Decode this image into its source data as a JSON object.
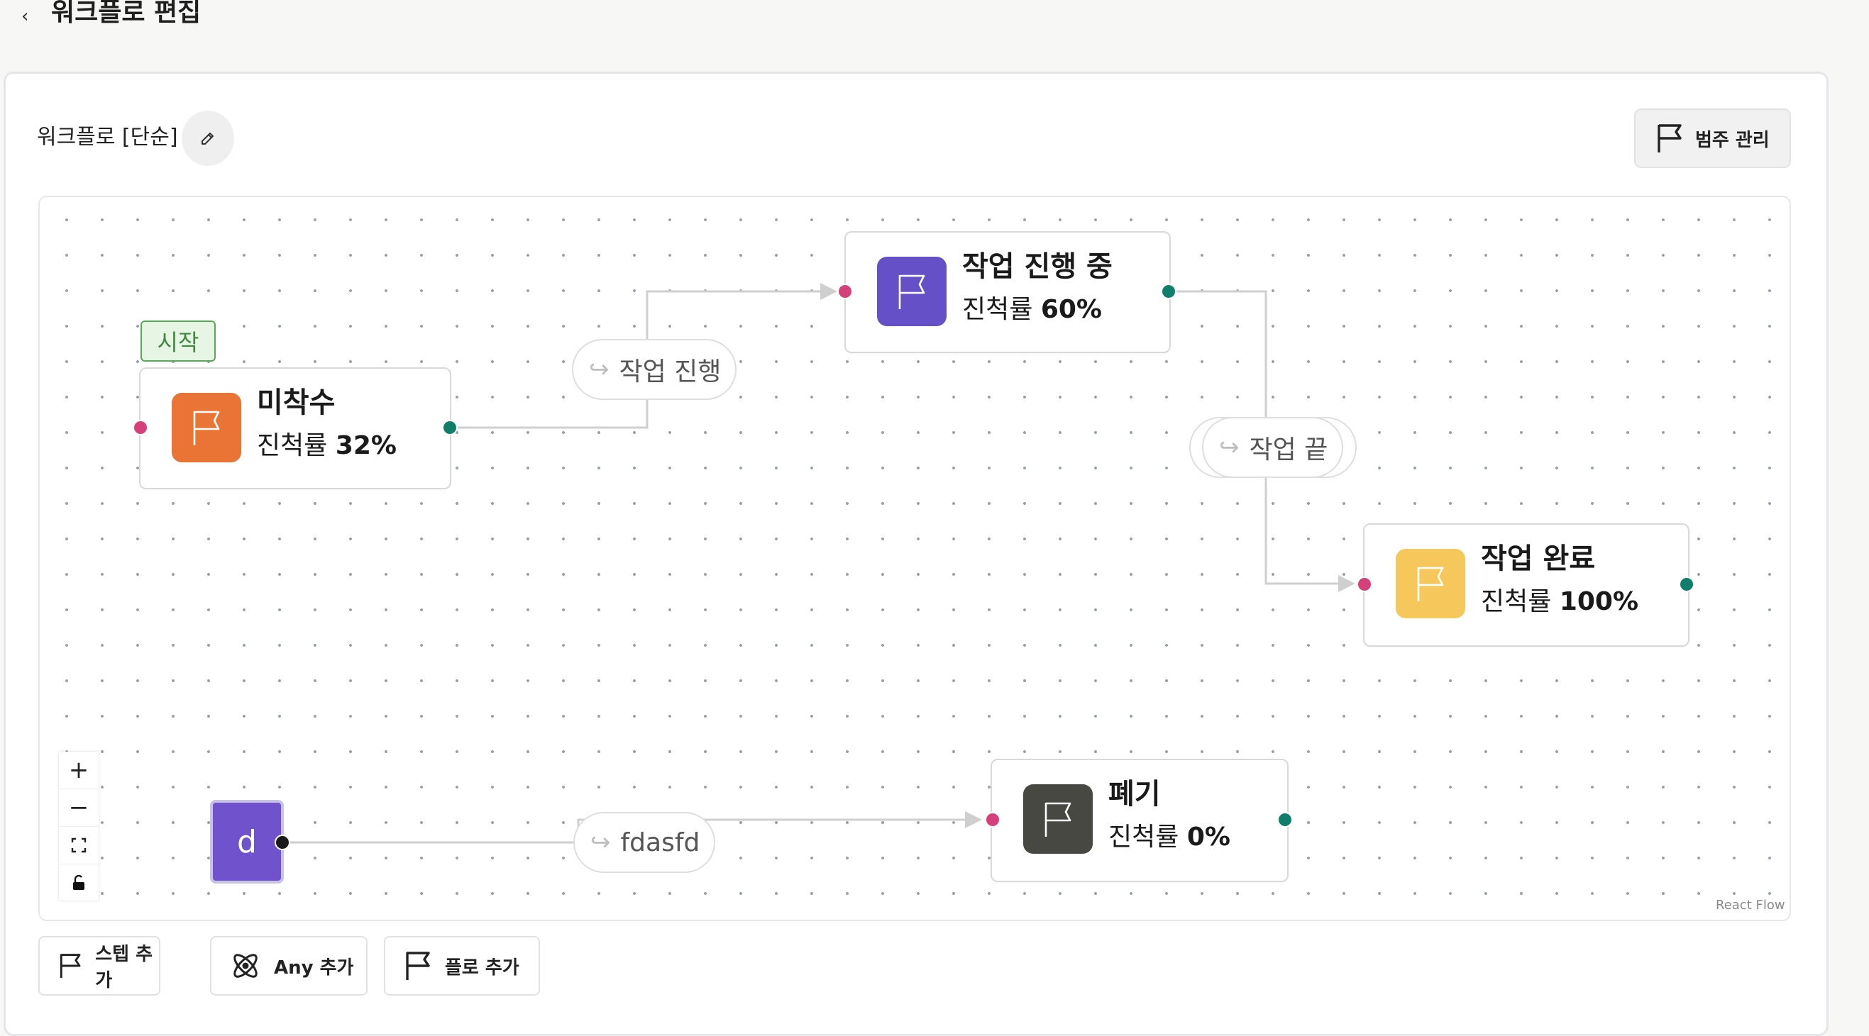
{
  "header": {
    "back_icon": "chevron-left-icon",
    "title": "워크플로 편집"
  },
  "workflow": {
    "name": "워크플로 [단순]",
    "edit_icon": "pencil-icon"
  },
  "toolbar": {
    "category_label": "범주 관리",
    "category_icon": "flag-icon"
  },
  "canvas": {
    "start_badge": "시작",
    "nodes": [
      {
        "title": "미착수",
        "progress_label": "진척률",
        "progress": "32%",
        "color": "#ea7435"
      },
      {
        "title": "작업 진행 중",
        "progress_label": "진척률",
        "progress": "60%",
        "color": "#6650c8"
      },
      {
        "title": "작업 완료",
        "progress_label": "진척률",
        "progress": "100%",
        "color": "#f6c75a"
      },
      {
        "title": "폐기",
        "progress_label": "진척률",
        "progress": "0%",
        "color": "#484843"
      }
    ],
    "any_node": {
      "label": "d",
      "color": "#6f52cc"
    },
    "edge_labels": [
      "작업 진행",
      "작업 끝",
      "fdasfd"
    ],
    "controls": [
      "+",
      "−",
      "fit-view-icon",
      "lock-icon"
    ],
    "attribution": "React Flow"
  },
  "bottom": {
    "add_step": "스텝 추가",
    "add_any": "Any 추가",
    "add_flow": "플로 추가"
  },
  "colors": {
    "handle_in": "#d63f7a",
    "handle_out": "#0f7f6c",
    "edge": "#cfcfcf"
  }
}
